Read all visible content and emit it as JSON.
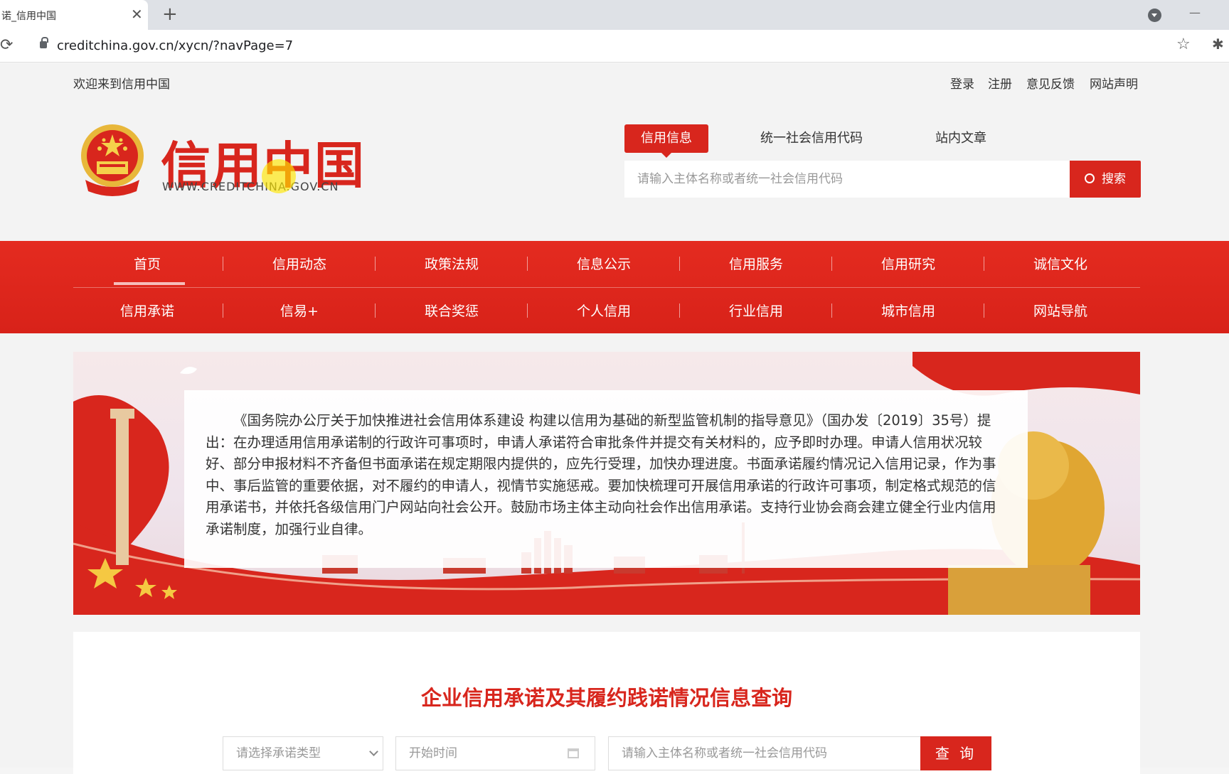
{
  "browser": {
    "tab_title": "诺_信用中国",
    "tab_close": "✕",
    "new_tab": "+",
    "minimize": "—",
    "reload": "⟳",
    "url": "creditchina.gov.cn/xycn/?navPage=7",
    "star": "☆",
    "extensions": "✱"
  },
  "topbar": {
    "welcome": "欢迎来到信用中国",
    "links": [
      "登录",
      "注册",
      "意见反馈",
      "网站声明"
    ]
  },
  "logo": {
    "title": "信用中国",
    "subtitle": "WWW.CREDITCHINA.GOV.CN"
  },
  "search": {
    "tabs": [
      "信用信息",
      "统一社会信用代码",
      "站内文章"
    ],
    "placeholder": "请输入主体名称或者统一社会信用代码",
    "button": "搜索",
    "button_icon": "search-icon"
  },
  "nav": {
    "row1": [
      "首页",
      "信用动态",
      "政策法规",
      "信息公示",
      "信用服务",
      "信用研究",
      "诚信文化"
    ],
    "row2": [
      "信用承诺",
      "信易+",
      "联合奖惩",
      "个人信用",
      "行业信用",
      "城市信用",
      "网站导航"
    ],
    "active": "首页"
  },
  "banner": {
    "text": "《国务院办公厅关于加快推进社会信用体系建设 构建以信用为基础的新型监管机制的指导意见》（国办发〔2019〕35号）提出：在办理适用信用承诺制的行政许可事项时，申请人承诺符合审批条件并提交有关材料的，应予即时办理。申请人信用状况较好、部分申报材料不齐备但书面承诺在规定期限内提供的，应先行受理，加快办理进度。书面承诺履约情况记入信用记录，作为事中、事后监管的重要依据，对不履约的申请人，视情节实施惩戒。要加快梳理可开展信用承诺的行政许可事项，制定格式规范的信用承诺书，并依托各级信用门户网站向社会公开。鼓励市场主体主动向社会作出信用承诺。支持行业协会商会建立健全行业内信用承诺制度，加强行业自律。"
  },
  "query": {
    "title": "企业信用承诺及其履约践诺情况信息查询",
    "type_placeholder": "请选择承诺类型",
    "start_placeholder": "开始时间",
    "name_placeholder": "请输入主体名称或者统一社会信用代码",
    "button": "查 询"
  },
  "colors": {
    "brand_red": "#d8261d"
  }
}
